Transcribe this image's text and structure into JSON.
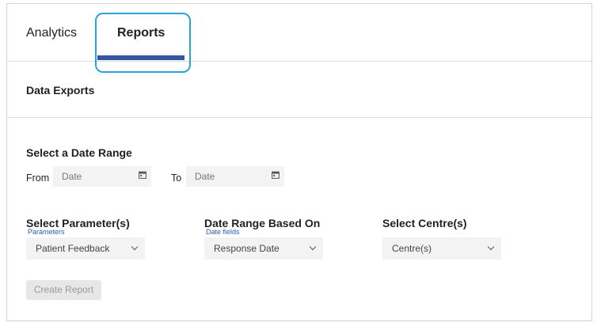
{
  "tabs": {
    "analytics": "Analytics",
    "reports": "Reports"
  },
  "section": {
    "title": "Data Exports"
  },
  "date_range": {
    "heading": "Select a Date Range",
    "from_label": "From",
    "to_label": "To",
    "from_placeholder": "Date",
    "to_placeholder": "Date"
  },
  "parameters": {
    "heading": "Select Parameter(s)",
    "caption": "Parameters",
    "value": "Patient Feedback"
  },
  "date_basis": {
    "heading": "Date Range Based On",
    "caption": "Date fields",
    "value": "Response Date"
  },
  "centres": {
    "heading": "Select Centre(s)",
    "value": "Centre(s)"
  },
  "actions": {
    "create_report": "Create Report"
  },
  "colors": {
    "accent": "#34579f",
    "focus_ring": "#2aa3dc"
  }
}
